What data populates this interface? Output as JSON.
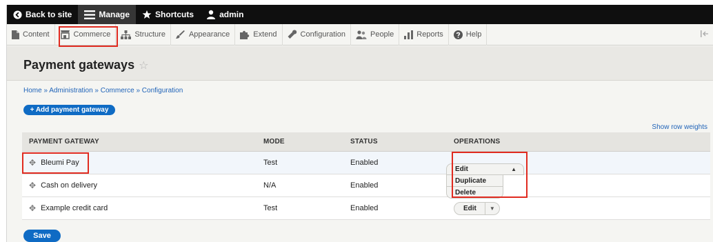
{
  "toolbar": {
    "back_label": "Back to site",
    "manage_label": "Manage",
    "shortcuts_label": "Shortcuts",
    "user_label": "admin"
  },
  "tray": {
    "items": [
      {
        "label": "Content",
        "icon": "document-icon"
      },
      {
        "label": "Commerce",
        "icon": "shop-icon"
      },
      {
        "label": "Structure",
        "icon": "sitemap-icon"
      },
      {
        "label": "Appearance",
        "icon": "brush-icon"
      },
      {
        "label": "Extend",
        "icon": "puzzle-icon"
      },
      {
        "label": "Configuration",
        "icon": "wrench-icon"
      },
      {
        "label": "People",
        "icon": "people-icon"
      },
      {
        "label": "Reports",
        "icon": "bar-chart-icon"
      },
      {
        "label": "Help",
        "icon": "help-icon"
      }
    ]
  },
  "page": {
    "title": "Payment gateways",
    "breadcrumb": [
      "Home",
      "Administration",
      "Commerce",
      "Configuration"
    ],
    "breadcrumb_sep": "»",
    "add_button": "+ Add payment gateway",
    "row_weights_link": "Show row weights",
    "save_button": "Save"
  },
  "table": {
    "headers": [
      "PAYMENT GATEWAY",
      "MODE",
      "STATUS",
      "OPERATIONS"
    ],
    "rows": [
      {
        "name": "Bleumi Pay",
        "mode": "Test",
        "status": "Enabled"
      },
      {
        "name": "Cash on delivery",
        "mode": "N/A",
        "status": "Enabled"
      },
      {
        "name": "Example credit card",
        "mode": "Test",
        "status": "Enabled"
      }
    ],
    "operations": {
      "edit": "Edit",
      "duplicate": "Duplicate",
      "delete": "Delete"
    }
  },
  "colors": {
    "accent": "#0f6bc4",
    "link": "#1f63b8",
    "highlight": "#e02a1f",
    "toolbar": "#0f0f0f"
  }
}
